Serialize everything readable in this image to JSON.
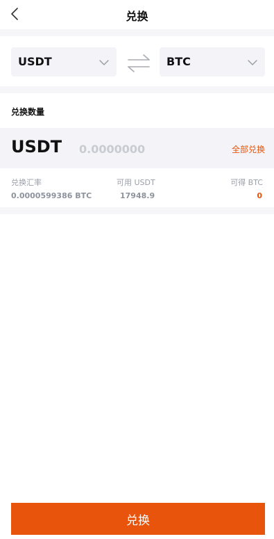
{
  "header": {
    "title": "兑换",
    "back_icon": "chevron-left-icon"
  },
  "selectors": {
    "from": {
      "value": "USDT",
      "icon": "chevron-down-icon"
    },
    "swap_icon": "swap-arrows-icon",
    "to": {
      "value": "BTC",
      "icon": "chevron-down-icon"
    }
  },
  "amount": {
    "section_title": "兑换数量",
    "currency": "USDT",
    "placeholder": "0.0000000",
    "exchange_all_label": "全部兑换"
  },
  "info": {
    "rate_label": "兑换汇率",
    "rate_value": "0.0000599386 BTC",
    "available_label": "可用 USDT",
    "available_value": "17948.9",
    "receive_label": "可得 BTC",
    "receive_value": "0"
  },
  "submit_label": "兑换",
  "colors": {
    "accent": "#e8540c",
    "page_band": "#f6f6f9",
    "field_background": "#f4f4f8",
    "muted_text": "#9a9ea7"
  }
}
